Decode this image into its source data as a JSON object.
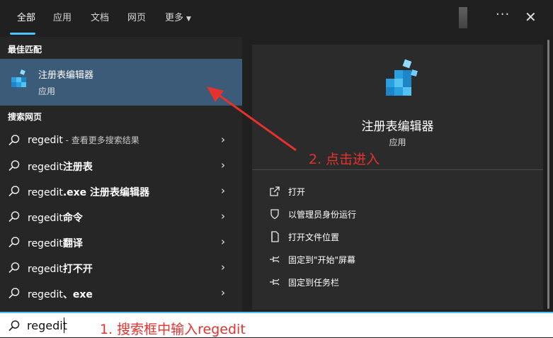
{
  "tabs": [
    {
      "label": "全部"
    },
    {
      "label": "应用"
    },
    {
      "label": "文档"
    },
    {
      "label": "网页"
    },
    {
      "label": "更多"
    }
  ],
  "window_controls": {
    "more": "···",
    "close": "✕"
  },
  "left_panel": {
    "best_match_title": "最佳匹配",
    "best_match": {
      "name": "注册表编辑器",
      "type": "应用"
    },
    "web_title": "搜索网页",
    "results": [
      {
        "bold": "",
        "text": "regedit",
        "muted": " - 查看更多搜索结果"
      },
      {
        "bold": "注册表",
        "text": "regedit",
        "muted": ""
      },
      {
        "bold": ".exe 注册表编辑器",
        "text": "regedit",
        "muted": ""
      },
      {
        "bold": "命令",
        "text": "regedit",
        "muted": ""
      },
      {
        "bold": "翻译",
        "text": "regedit",
        "muted": ""
      },
      {
        "bold": "打不开",
        "text": "regedit",
        "muted": ""
      },
      {
        "bold": "、exe",
        "text": "regedit",
        "muted": ""
      }
    ]
  },
  "right_panel": {
    "app_name": "注册表编辑器",
    "app_type": "应用",
    "actions": [
      {
        "label": "打开",
        "icon": "open-icon"
      },
      {
        "label": "以管理员身份运行",
        "icon": "shield-icon"
      },
      {
        "label": "打开文件位置",
        "icon": "file-location-icon"
      },
      {
        "label": "固定到\"开始\"屏幕",
        "icon": "pin-icon"
      },
      {
        "label": "固定到任务栏",
        "icon": "pin-icon"
      }
    ]
  },
  "search": {
    "value": "regedit"
  },
  "annotations": {
    "step1": "1. 搜索框中输入regedit",
    "step2": "2. 点击进入"
  },
  "colors": {
    "accent": "#4cc2ff",
    "selected": "#3b5b78",
    "annotation": "#e5322d"
  }
}
